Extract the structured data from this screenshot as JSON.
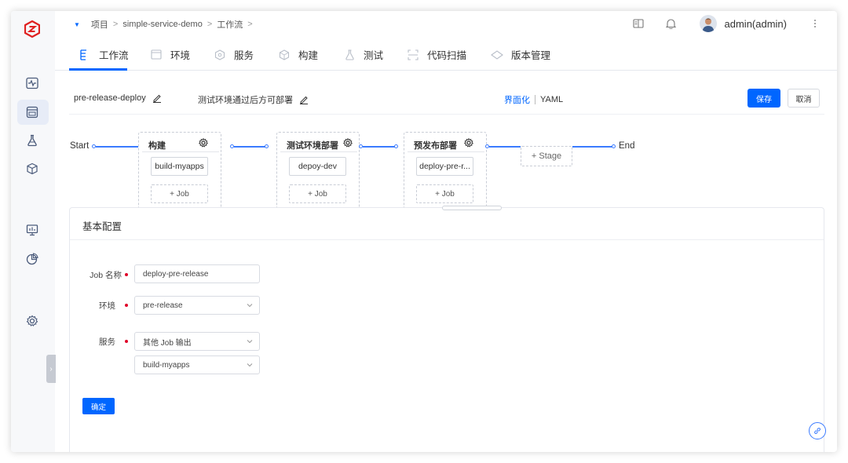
{
  "breadcrumb": {
    "items": [
      "项目",
      "simple-service-demo",
      "工作流"
    ],
    "separator": ">"
  },
  "user": {
    "name": "admin(admin)"
  },
  "tabs": [
    {
      "label": "工作流",
      "icon": "workflow-icon"
    },
    {
      "label": "环境",
      "icon": "environment-icon"
    },
    {
      "label": "服务",
      "icon": "service-icon"
    },
    {
      "label": "构建",
      "icon": "build-icon"
    },
    {
      "label": "测试",
      "icon": "test-icon"
    },
    {
      "label": "代码扫描",
      "icon": "code-scan-icon"
    },
    {
      "label": "版本管理",
      "icon": "version-icon"
    }
  ],
  "workflow": {
    "name": "pre-release-deploy",
    "description": "测试环境通过后方可部署",
    "mode": {
      "visual": "界面化",
      "yaml": "YAML"
    },
    "save_label": "保存",
    "cancel_label": "取消"
  },
  "pipeline": {
    "start": "Start",
    "end": "End",
    "add_stage": "+ Stage",
    "add_job": "+ Job",
    "stages": [
      {
        "title": "构建",
        "job": "build-myapps"
      },
      {
        "title": "测试环境部署",
        "job": "depoy-dev"
      },
      {
        "title": "预发布部署",
        "job": "deploy-pre-r..."
      }
    ]
  },
  "config": {
    "title": "基本配置",
    "job_name_label": "Job 名称",
    "job_name_value": "deploy-pre-release",
    "env_label": "环境",
    "env_value": "pre-release",
    "service_label": "服务",
    "service_source": "其他 Job 输出",
    "service_job": "build-myapps",
    "confirm_label": "确定"
  },
  "colors": {
    "accent": "#0066ff",
    "required": "#e00028"
  }
}
